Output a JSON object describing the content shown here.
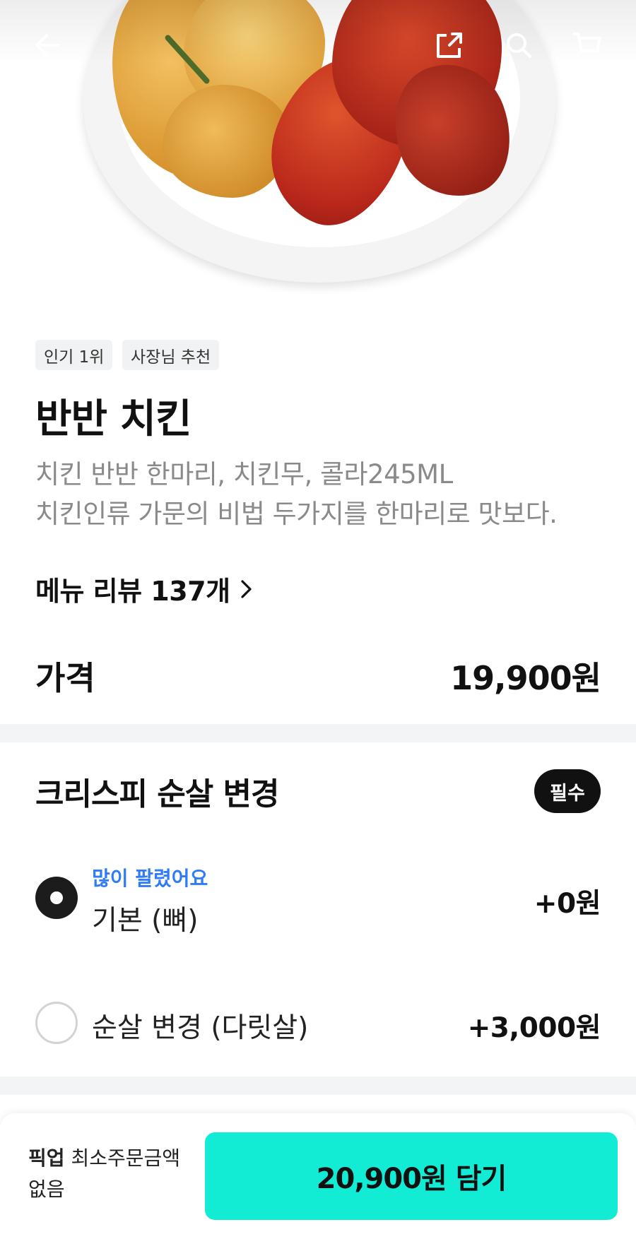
{
  "hero": {
    "image_alt": "반반 치킨",
    "icons": [
      "back-arrow-icon",
      "share-icon",
      "search-icon",
      "cart-icon"
    ]
  },
  "tags": [
    "인기 1위",
    "사장님 추천"
  ],
  "menu": {
    "title": "반반 치킨",
    "description": [
      "치킨 반반 한마리, 치킨무, 콜라245ML",
      "치킨인류 가문의 비법 두가지를 한마리로 맛보다."
    ],
    "review_link": "메뉴 리뷰 137개",
    "price_label": "가격",
    "price_value": "19,900원"
  },
  "option_group": {
    "title": "크리스피 순살 변경",
    "badge": "필수",
    "options": [
      {
        "hint": "많이 팔렸어요",
        "label": "기본 (뼈)",
        "price": "+0원",
        "selected": true
      },
      {
        "label": "순살 변경 (다릿살)",
        "price": "+3,000원",
        "selected": false
      }
    ]
  },
  "bottom": {
    "pickup_bold": "픽업",
    "pickup_text": "최소주문금액",
    "pickup_text2": "없음",
    "cart_button": "20,900원 담기"
  },
  "colors": {
    "accent": "#12ecd4",
    "hint_blue": "#2f7cf6",
    "divider": "#f3f4f6"
  }
}
